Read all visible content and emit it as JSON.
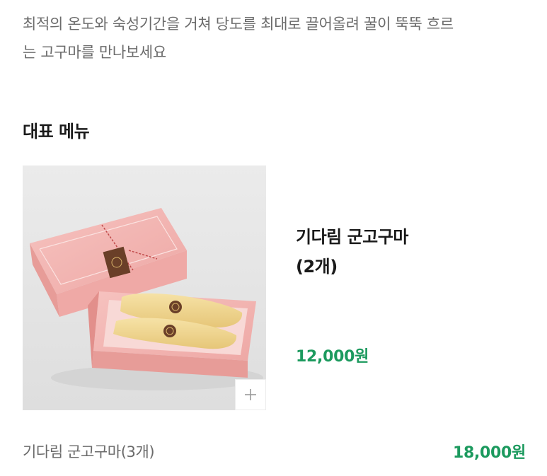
{
  "intro": {
    "line1": "최적의 온도와 숙성기간을 거쳐 당도를 최대로 끌어올려 꿀이 뚝뚝 흐르",
    "line2": "는 고구마를 만나보세요"
  },
  "section": {
    "title": "대표 메뉴"
  },
  "featured_menu": {
    "name_line1": "기다림 군고구마",
    "name_line2": "(2개)",
    "price": "12,000원",
    "image_icon": "product-photo-pink-gift-box",
    "add_icon": "plus-icon"
  },
  "menu_list": [
    {
      "name": "기다림 군고구마(3개)",
      "price": "18,000원"
    }
  ],
  "colors": {
    "price": "#1c9a5e",
    "body_text": "#6b6b6b",
    "heading": "#1a1a1a",
    "box_pink": "#f3b3b0"
  }
}
